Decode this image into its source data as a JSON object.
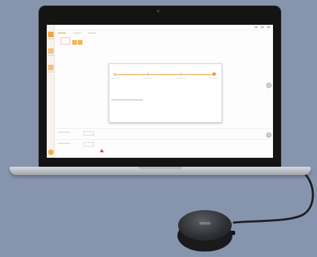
{
  "scene": {
    "background_color": "#8794ad",
    "objects": [
      "laptop",
      "usb-puck-device",
      "usb-cable"
    ]
  },
  "screen": {
    "accent_color": "#f29a2e",
    "dialog": {
      "wizard_steps": 4,
      "active_step": 4
    }
  }
}
